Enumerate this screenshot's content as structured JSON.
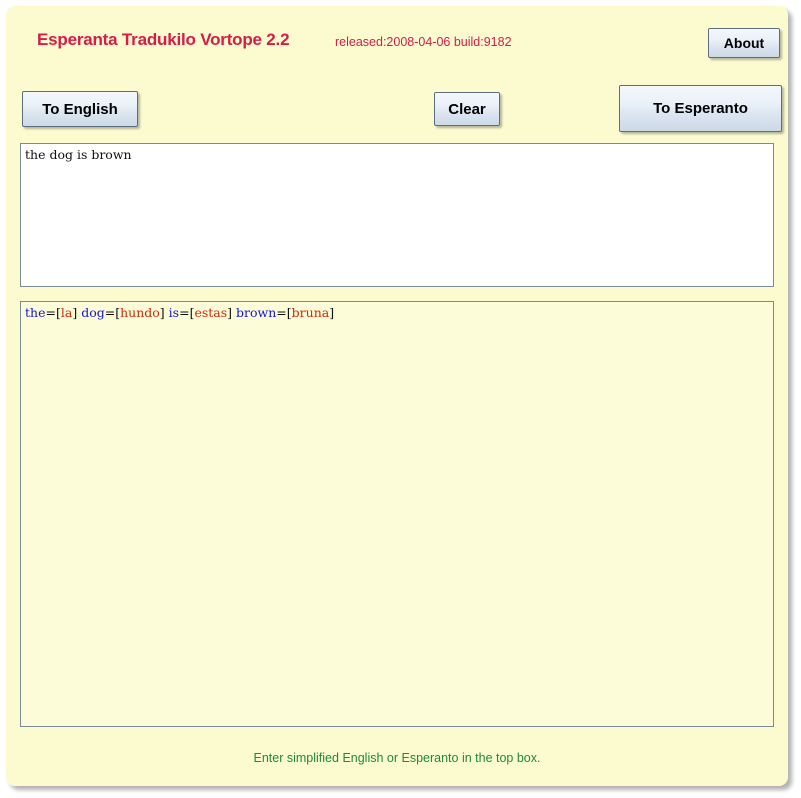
{
  "window": {
    "background_color": "#fcfbd0",
    "shadow": true
  },
  "header": {
    "title": "Esperanta Tradukilo Vortope 2.2",
    "title_color": "#d81b47",
    "build_info": "released:2008-04-06 build:9182",
    "build_info_color": "#d81b47",
    "about_label": "About"
  },
  "toolbar": {
    "to_english_label": "To English",
    "clear_label": "Clear",
    "to_esperanto_label": "To Esperanto"
  },
  "input_box": {
    "value": "the dog is brown",
    "placeholder": ""
  },
  "output_box": {
    "raw_text": "the=[la] dog=[hundo] is=[estas] brown=[bruna]",
    "source_color": "#1414e0",
    "target_color": "#d02a0a",
    "tokens": [
      {
        "source": "the",
        "target": "la"
      },
      {
        "source": "dog",
        "target": "hundo"
      },
      {
        "source": "is",
        "target": "estas"
      },
      {
        "source": "brown",
        "target": "bruna"
      }
    ]
  },
  "status": {
    "text": "Enter simplified English or Esperanto in the top box.",
    "color": "#1f8a3b"
  }
}
